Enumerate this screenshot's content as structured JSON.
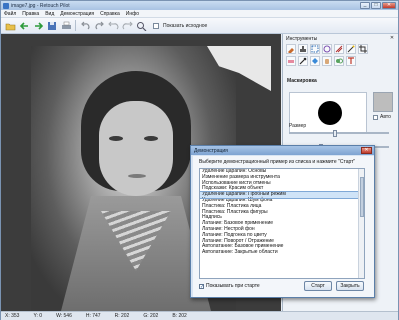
{
  "window": {
    "title": "image7.jpg - Retouch Pilot",
    "controls": [
      "_",
      "□",
      "✕"
    ]
  },
  "menu": [
    "Файл",
    "Правка",
    "Вид",
    "Демонстрация",
    "Справка",
    "Инфо"
  ],
  "toolbar": {
    "icons": [
      "open-icon",
      "back-icon",
      "forward-icon",
      "save-icon",
      "print-icon",
      "undo-icon",
      "redo-icon",
      "undo-all-icon",
      "redo-all-icon",
      "zoom-icon"
    ],
    "show_original_label": "Показать исходное"
  },
  "panel": {
    "title": "Инструменты",
    "close": "✕",
    "mask_section": "Маскировка",
    "auto_label": "Авто",
    "size_label": "Размер",
    "size_value": 0.45,
    "second_slider_value": 0.3
  },
  "status": {
    "x": "X: 353",
    "y": "Y: 0",
    "w": "W: 546",
    "h": "H: 747",
    "r": "R: 202",
    "g": "G: 202",
    "b": "B: 202"
  },
  "dialog": {
    "title": "Демонстрация",
    "close": "✕",
    "prompt": "Выберите демонстрационный пример из списка и нажмите \"Старт\"",
    "items": [
      "Удаление царапин: Основы",
      "Изменение размера инструмента",
      "Использование кисти отмены",
      "Подсказки: Красим объект",
      "Удаление царапин: Пробный режим",
      "Удаление царапин: Шум фона",
      "Пластика: Пластика лица",
      "Пластика: Пластика фигуры",
      "Надпись",
      "Латание: Базовое применение",
      "Латание: Нестрой фон",
      "Латание: Подгонка по цвету",
      "Латание: Поворот / Отражение",
      "Автолатание: Базовое применение",
      "Автолатание: Закрытые области"
    ],
    "selected_index": 4,
    "show_on_start": "Показывать при старте",
    "start": "Старт",
    "close_btn": "Закрыть"
  }
}
